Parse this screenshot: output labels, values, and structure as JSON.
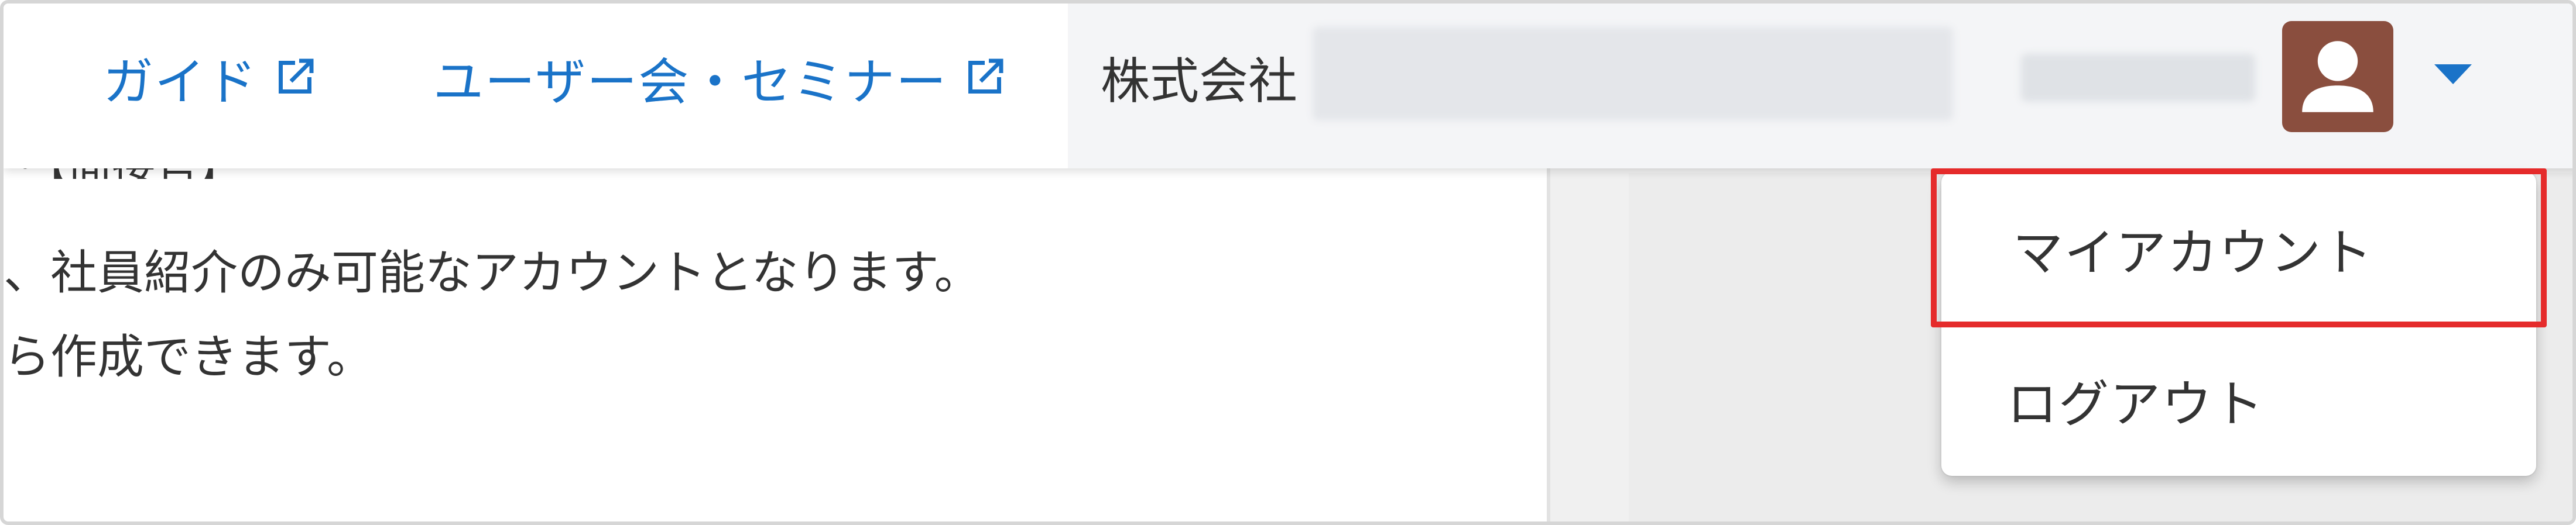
{
  "header": {
    "nav": [
      {
        "label": "ガイド",
        "icon": "external-link-icon"
      },
      {
        "label": "ユーザー会・セミナー",
        "icon": "external-link-icon"
      }
    ],
    "company_prefix": "株式会社",
    "user_icon": "user-avatar-icon",
    "menu_toggle_icon": "caret-down-icon"
  },
  "body": {
    "line1": "・【面接官】",
    "line2": "、社員紹介のみ可能なアカウントとなります。",
    "line3": "ら作成できます。"
  },
  "dropdown": {
    "items": [
      {
        "label": "マイアカウント"
      },
      {
        "label": "ログアウト"
      }
    ]
  },
  "colors": {
    "link": "#1a73c8",
    "highlight": "#e52b2b",
    "avatar_bg": "#8a4e3e"
  }
}
